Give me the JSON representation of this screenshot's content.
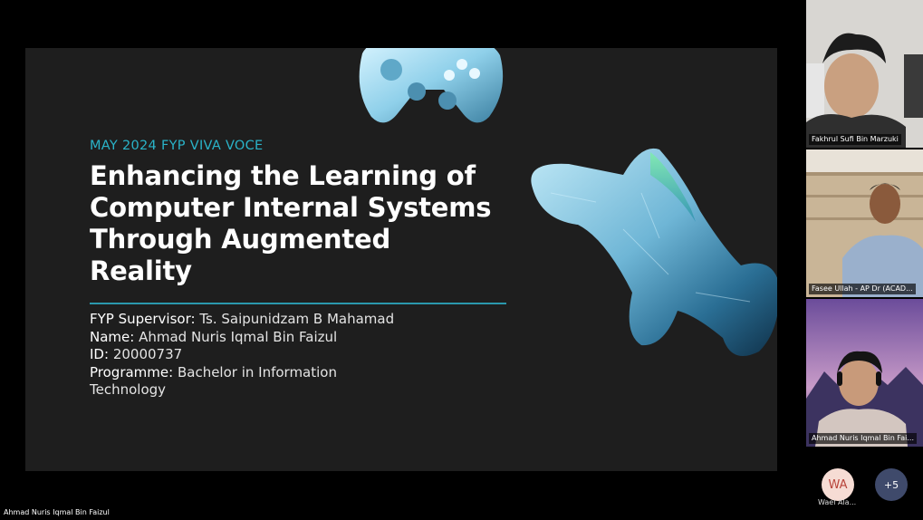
{
  "slide": {
    "kicker": "MAY 2024 FYP VIVA VOCE",
    "title_lines": [
      "Enhancing the Learning of",
      "Computer Internal Systems",
      "Through Augmented",
      "Reality"
    ],
    "details": [
      {
        "label": "FYP Supervisor:",
        "value": "Ts. Saipunidzam B Mahamad"
      },
      {
        "label": "Name:",
        "value": "Ahmad Nuris Iqmal Bin Faizul"
      },
      {
        "label": "ID:",
        "value": "20000737"
      },
      {
        "label": "Programme:",
        "value": "Bachelor in Information"
      },
      {
        "label": "",
        "value": "Technology"
      }
    ]
  },
  "participants": [
    {
      "name": "Fakhrul Sufi Bin Marzuki"
    },
    {
      "name": "Fasee Ullah - AP Dr (ACAD..."
    },
    {
      "name": "Ahmad Nuris Iqmal Bin Fai..."
    }
  ],
  "avatar": {
    "initials": "WA",
    "name": "Wael Ala..."
  },
  "more_participants": "+5",
  "presenter": "Ahmad Nuris Iqmal Bin Faizul",
  "colors": {
    "accent": "#2ab3c8",
    "slide_bg": "#1e1e1e",
    "avatar_bg": "#f6dcd4",
    "more_bg": "#3f4a6b"
  }
}
